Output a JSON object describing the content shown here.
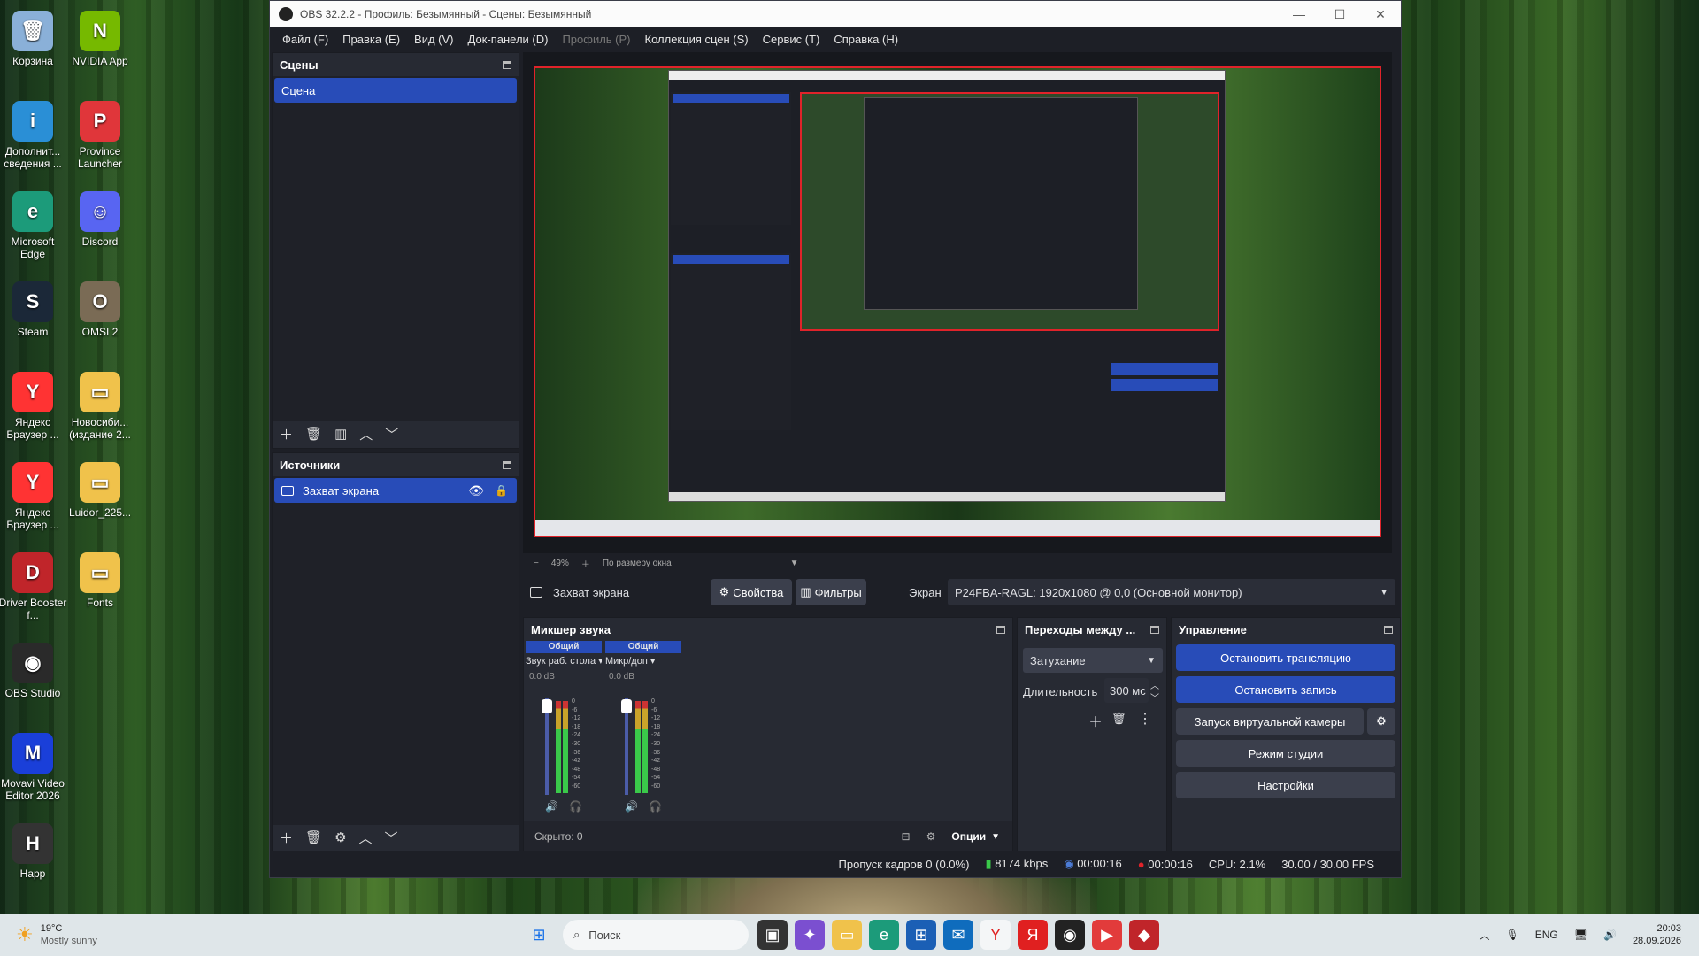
{
  "desktop": {
    "icons_left": [
      {
        "label": "Корзина",
        "color": "#8ab0d8",
        "glyph": "🗑"
      },
      {
        "label": "Дополнит... сведения ...",
        "color": "#2a8fd6",
        "glyph": "i"
      },
      {
        "label": "Microsoft Edge",
        "color": "#1c9b7a",
        "glyph": "e"
      },
      {
        "label": "Steam",
        "color": "#1b2838",
        "glyph": "S"
      },
      {
        "label": "Яндекс Браузер ...",
        "color": "#ff3333",
        "glyph": "Y"
      },
      {
        "label": "Яндекс Браузер ...",
        "color": "#ff3333",
        "glyph": "Y"
      },
      {
        "label": "Driver Booster f...",
        "color": "#c0252a",
        "glyph": "D"
      },
      {
        "label": "OBS Studio",
        "color": "#2a2a2a",
        "glyph": "◉"
      },
      {
        "label": "Movavi Video Editor 2026",
        "color": "#1a3fd9",
        "glyph": "M"
      },
      {
        "label": "Happ",
        "color": "#333",
        "glyph": "H"
      }
    ],
    "icons_right": [
      {
        "label": "NVIDIA App",
        "color": "#76b900",
        "glyph": "N"
      },
      {
        "label": "Province Launcher",
        "color": "#e0363a",
        "glyph": "P"
      },
      {
        "label": "Discord",
        "color": "#5865f2",
        "glyph": "☺"
      },
      {
        "label": "OMSI 2",
        "color": "#7a6b55",
        "glyph": "O"
      },
      {
        "label": "Новосиби... (издание 2...",
        "color": "#f0c24b",
        "glyph": "▭"
      },
      {
        "label": "Luidor_225...",
        "color": "#f0c24b",
        "glyph": "▭"
      },
      {
        "label": "Fonts",
        "color": "#f0c24b",
        "glyph": "▭"
      }
    ]
  },
  "window": {
    "title": "OBS 32.2.2 - Профиль: Безымянный - Сцены: Безымянный",
    "menu": [
      "Файл (F)",
      "Правка (E)",
      "Вид (V)",
      "Док-панели (D)",
      "Профиль (P)",
      "Коллекция сцен (S)",
      "Сервис (T)",
      "Справка (H)"
    ]
  },
  "scenes": {
    "title": "Сцены",
    "items": [
      "Сцена"
    ]
  },
  "sources": {
    "title": "Источники",
    "items": [
      "Захват экрана"
    ]
  },
  "preview": {
    "zoom": "49%",
    "fit": "По размеру окна"
  },
  "source_bar": {
    "name": "Захват экрана",
    "properties": "Свойства",
    "filters": "Фильтры",
    "screen_label": "Экран",
    "screen_value": "P24FBA-RAGL: 1920x1080 @ 0,0 (Основной монитор)"
  },
  "mixer": {
    "title": "Микшер звука",
    "channels": [
      {
        "tag": "Общий",
        "name": "Звук раб. стола",
        "db": "0.0 dB"
      },
      {
        "tag": "Общий",
        "name": "Микр/доп",
        "db": "0.0 dB"
      }
    ],
    "scale": [
      "0",
      "-6",
      "-12",
      "-18",
      "-24",
      "-30",
      "-36",
      "-42",
      "-48",
      "-54",
      "-60"
    ],
    "hidden": "Скрыто: 0",
    "options": "Опции"
  },
  "transitions": {
    "title": "Переходы между ...",
    "type": "Затухание",
    "duration_label": "Длительность",
    "duration_value": "300 мс"
  },
  "controls": {
    "title": "Управление",
    "stop_stream": "Остановить трансляцию",
    "stop_record": "Остановить запись",
    "virtual_cam": "Запуск виртуальной камеры",
    "studio_mode": "Режим студии",
    "settings": "Настройки"
  },
  "status": {
    "dropped": "Пропуск кадров 0 (0.0%)",
    "bitrate": "8174 kbps",
    "stream_time": "00:00:16",
    "rec_time": "00:00:16",
    "cpu": "CPU: 2.1%",
    "fps": "30.00 / 30.00 FPS"
  },
  "taskbar": {
    "weather_temp": "19°C",
    "weather_desc": "Mostly sunny",
    "search": "Поиск",
    "lang": "ENG",
    "time": "20:03",
    "date": "28.09.2026"
  }
}
